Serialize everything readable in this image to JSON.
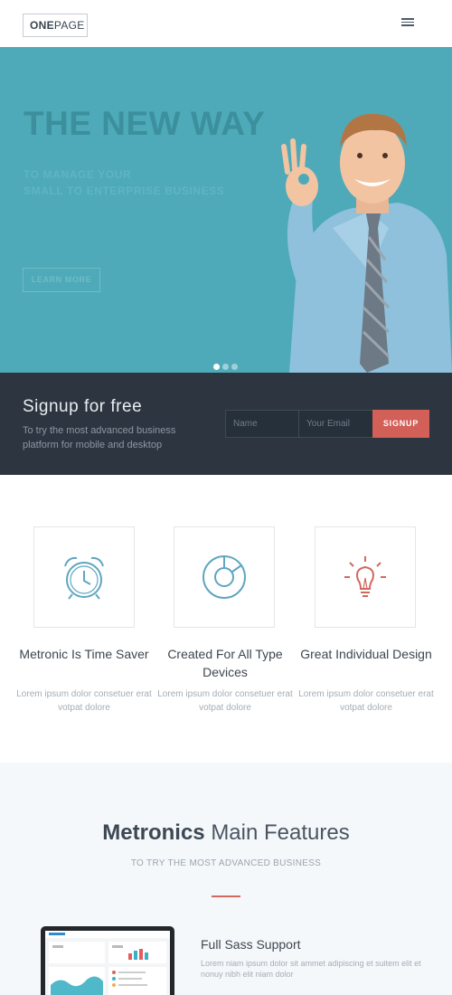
{
  "header": {
    "logo_bold": "ONE",
    "logo_light": "PAGE",
    "menu_icon": "hamburger-icon"
  },
  "hero": {
    "title": "THE NEW WAY",
    "subtitle_line1": "TO MANAGE YOUR",
    "subtitle_line2": "SMALL TO ENTERPRISE BUSINESS",
    "button_label": "LEARN MORE",
    "slides": 3,
    "active_slide": 1,
    "background_color": "#4eaab8"
  },
  "signup": {
    "title": "Signup for free",
    "description": "To try the most advanced business platform for mobile and desktop",
    "name_placeholder": "Name",
    "email_placeholder": "Your Email",
    "button_label": "SIGNUP",
    "button_color": "#d25f58"
  },
  "features": [
    {
      "icon": "alarm-clock-icon",
      "title": "Metronic Is Time Saver",
      "description": "Lorem ipsum dolor consetuer erat votpat dolore"
    },
    {
      "icon": "pie-chart-icon",
      "title": "Created For All Type Devices",
      "description": "Lorem ipsum dolor consetuer erat votpat dolore"
    },
    {
      "icon": "lightbulb-icon",
      "title": "Great Individual Design",
      "description": "Lorem ipsum dolor consetuer erat votpat dolore"
    }
  ],
  "main_features": {
    "title_bold": "Metronics",
    "title_rest": "Main Features",
    "subtitle": "TO TRY THE MOST ADVANCED BUSINESS",
    "item_title": "Full Sass Support",
    "item_description": "Lorem niam ipsum dolor sit ammet adipiscing et suitem elit et nonuy nibh elit niam dolor",
    "accent_color": "#d2685e"
  }
}
